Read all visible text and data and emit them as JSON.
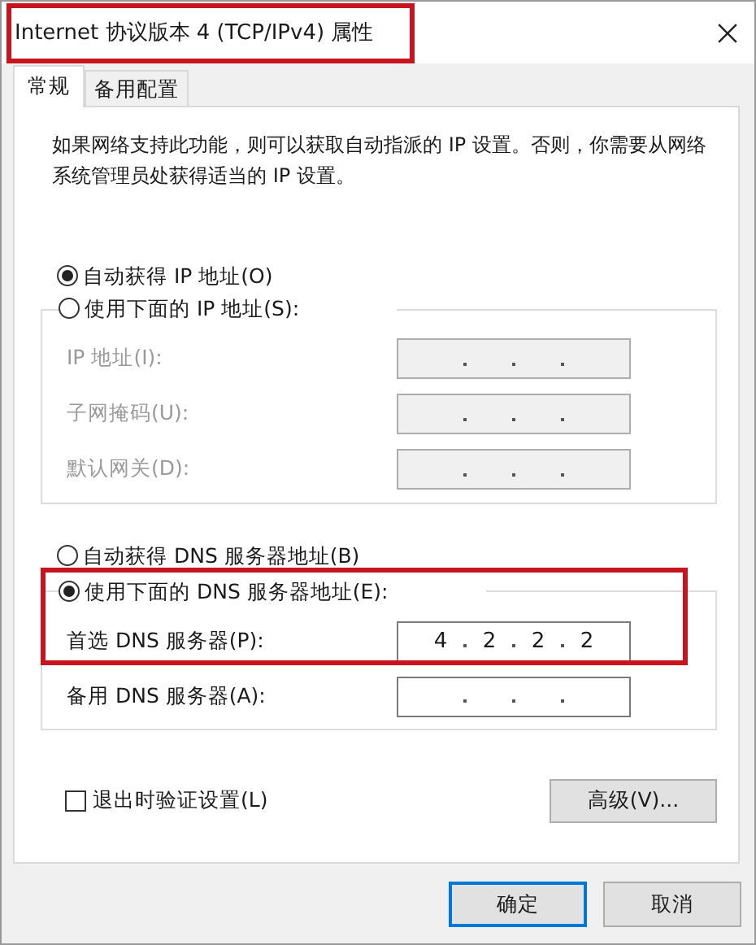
{
  "window": {
    "title": "Internet 协议版本 4 (TCP/IPv4) 属性",
    "title_highlighted": true
  },
  "tabs": [
    {
      "label": "常规",
      "selected": true
    },
    {
      "label": "备用配置",
      "selected": false
    }
  ],
  "description": "如果网络支持此功能，则可以获取自动指派的 IP 设置。否则，你需要从网络系统管理员处获得适当的 IP 设置。",
  "ip": {
    "auto_option": {
      "label": "自动获得 IP 地址(O)",
      "selected": true
    },
    "manual_option": {
      "label": "使用下面的 IP 地址(S):",
      "selected": false
    },
    "fields": [
      {
        "label": "IP 地址(I):",
        "disabled": true
      },
      {
        "label": "子网掩码(U):",
        "disabled": true
      },
      {
        "label": "默认网关(D):",
        "disabled": true
      }
    ]
  },
  "dns": {
    "highlighted": true,
    "auto_option": {
      "label": "自动获得 DNS 服务器地址(B)",
      "selected": false
    },
    "manual_option": {
      "label": "使用下面的 DNS 服务器地址(E):",
      "selected": true
    },
    "fields": [
      {
        "label": "首选 DNS 服务器(P):",
        "disabled": false,
        "octets": [
          "4",
          "2",
          "2",
          "2"
        ]
      },
      {
        "label": "备用 DNS 服务器(A):",
        "disabled": false
      }
    ]
  },
  "validate_checkbox": {
    "label": "退出时验证设置(L)",
    "checked": false
  },
  "advanced_button": "高级(V)...",
  "footer_buttons": [
    {
      "label": "确定",
      "default": true
    },
    {
      "label": "取消",
      "default": false
    }
  ]
}
